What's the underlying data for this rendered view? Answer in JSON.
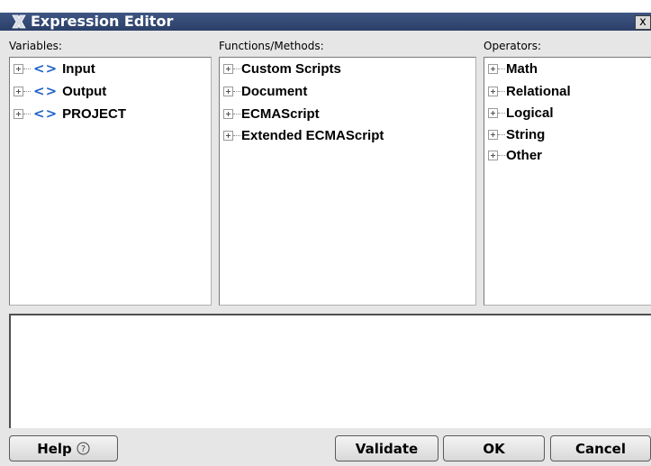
{
  "window": {
    "title": "Expression Editor",
    "close_glyph": "x"
  },
  "panels": {
    "variables": {
      "label": "Variables:",
      "items": [
        {
          "label": "Input",
          "icon": "<>"
        },
        {
          "label": "Output",
          "icon": "<>"
        },
        {
          "label": "PROJECT",
          "icon": "<>"
        }
      ]
    },
    "functions": {
      "label": "Functions/Methods:",
      "items": [
        {
          "label": "Custom Scripts"
        },
        {
          "label": "Document"
        },
        {
          "label": "ECMAScript"
        },
        {
          "label": "Extended ECMAScript"
        }
      ]
    },
    "operators": {
      "label": "Operators:",
      "items": [
        {
          "label": "Math"
        },
        {
          "label": "Relational"
        },
        {
          "label": "Logical"
        },
        {
          "label": "String"
        },
        {
          "label": "Other"
        }
      ]
    }
  },
  "editor": {
    "value": ""
  },
  "buttons": {
    "help": "Help",
    "help_icon": "?",
    "validate": "Validate",
    "ok": "OK",
    "cancel": "Cancel"
  },
  "colors": {
    "titlebar": "#34497a",
    "variable_icon": "#1e63c8"
  }
}
